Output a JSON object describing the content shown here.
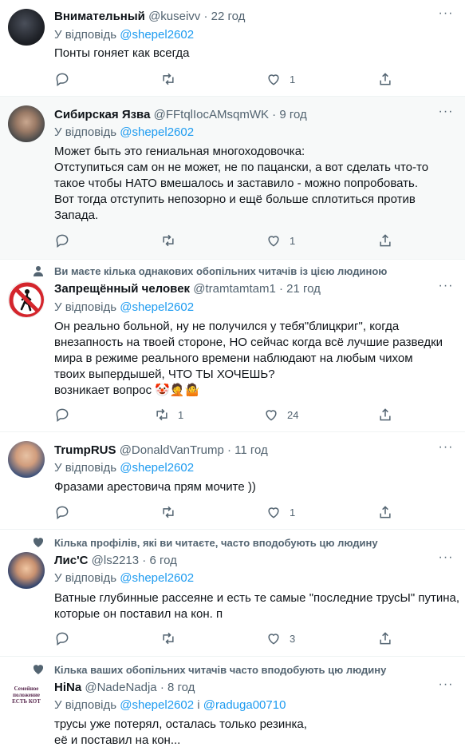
{
  "reply_prefix": "У відповідь",
  "and_word": "і",
  "tweets": [
    {
      "name": "Внимательный",
      "handle": "@kuseivv",
      "time": "22 год",
      "reply_to": "@shepel2602",
      "text": "Понты гоняет как всегда",
      "replies": "",
      "retweets": "",
      "likes": "1"
    },
    {
      "name": "Сибирская Язва",
      "handle": "@FFtqlIocAMsqmWK",
      "time": "9 год",
      "reply_to": "@shepel2602",
      "text": "Может быть это гениальная многоходовочка:\nОтступиться сам он не может, не по пацански, а вот сделать что-то такое чтобы НАТО вмешалось и заставило - можно попробовать.\nВот тогда отступить непозорно и ещё больше сплотиться против Запада.",
      "replies": "",
      "retweets": "",
      "likes": "1"
    },
    {
      "social": "Ви маєте кілька однакових обопільних читачів із цією людиною",
      "name": "Запрещённый человек",
      "handle": "@tramtamtam1",
      "time": "21 год",
      "reply_to": "@shepel2602",
      "text": "Он реально больной, ну не получился у тебя\"блицкриг\", когда внезапность на твоей стороне, НО сейчас когда всё лучшие разведки мира в режиме реального времени наблюдают на любым чихом твоих выпердышей, ЧТО ТЫ ХОЧЕШЬ?\nвозникает вопрос 🤡🤦🤷",
      "replies": "",
      "retweets": "1",
      "likes": "24"
    },
    {
      "name": "TrumpRUS",
      "handle": "@DonaldVanTrump",
      "time": "11 год",
      "reply_to": "@shepel2602",
      "text": "Фразами арестовича прям мочите ))",
      "replies": "",
      "retweets": "",
      "likes": "1"
    },
    {
      "social": "Кілька профілів, які ви читаєте, часто вподобують цю людину",
      "name": "Лис'С",
      "handle": "@ls2213",
      "time": "6 год",
      "reply_to": "@shepel2602",
      "text": "Ватные глубинные рассеяне и есть те самые \"последние трусЫ\" путина, которые он поставил на кон. п",
      "replies": "",
      "retweets": "",
      "likes": "3"
    },
    {
      "social": "Кілька ваших обопільних читачів часто вподобують цю людину",
      "name": "HiNa",
      "handle": "@NadeNadja",
      "time": "8 год",
      "reply_to": "@shepel2602",
      "reply_to_2": "@raduga00710",
      "text": "трусы уже потерял, осталась только резинка,\neё и поставил на кон...",
      "avatar_text": "Семейное положение ЕСТЬ КОТ"
    }
  ],
  "colors": {
    "accent": "#1d9bf0",
    "muted": "#536471",
    "text": "#0f1419"
  }
}
